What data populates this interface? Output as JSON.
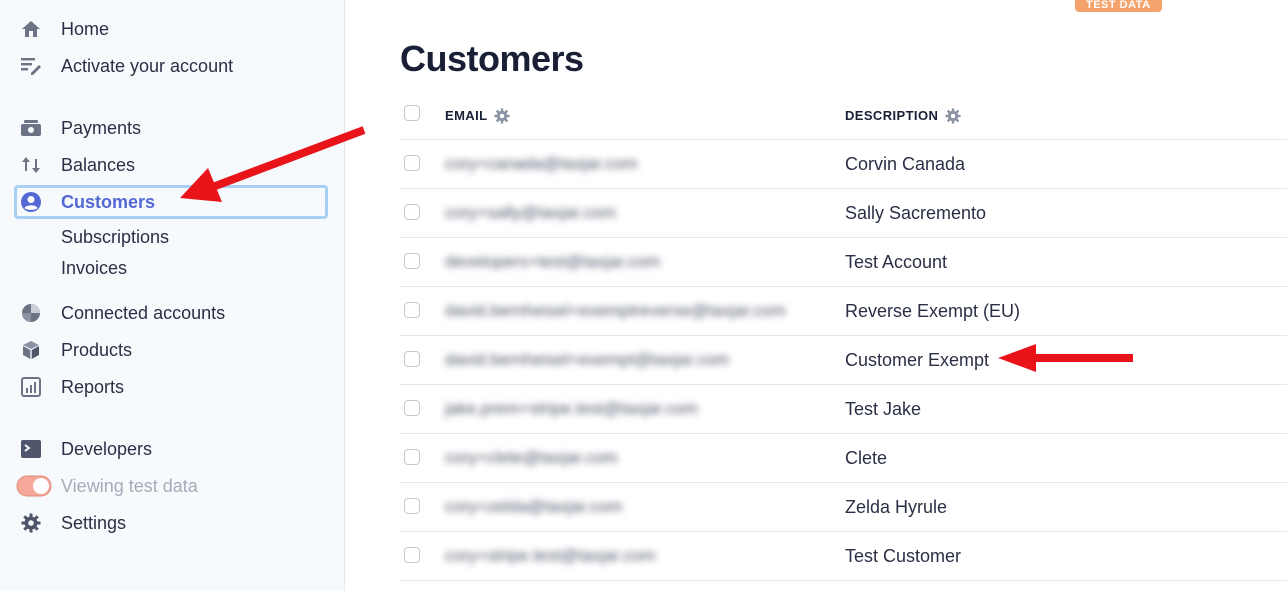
{
  "sidebar": {
    "items": [
      {
        "label": "Home",
        "icon": "home-icon"
      },
      {
        "label": "Activate your account",
        "icon": "edit-list-icon"
      },
      {
        "label": "Payments",
        "icon": "payments-icon"
      },
      {
        "label": "Balances",
        "icon": "balances-icon"
      },
      {
        "label": "Customers",
        "icon": "customers-icon",
        "active": true
      },
      {
        "label": "Subscriptions"
      },
      {
        "label": "Invoices"
      },
      {
        "label": "Connected accounts",
        "icon": "connected-accounts-icon"
      },
      {
        "label": "Products",
        "icon": "products-icon"
      },
      {
        "label": "Reports",
        "icon": "reports-icon"
      },
      {
        "label": "Developers",
        "icon": "terminal-icon"
      },
      {
        "label": "Viewing test data",
        "icon": "toggle-icon"
      },
      {
        "label": "Settings",
        "icon": "gear-icon"
      }
    ]
  },
  "badge": "TEST DATA",
  "main": {
    "title": "Customers",
    "columns": {
      "email": "EMAIL",
      "description": "DESCRIPTION"
    },
    "rows": [
      {
        "email": "cory+canada@taxjar.com",
        "description": "Corvin Canada"
      },
      {
        "email": "cory+sally@taxjar.com",
        "description": "Sally Sacremento"
      },
      {
        "email": "developers+test@taxjar.com",
        "description": "Test Account"
      },
      {
        "email": "david.bernheisel+exemptreverse@taxjar.com",
        "description": "Reverse Exempt (EU)"
      },
      {
        "email": "david.bernheisel+exempt@taxjar.com",
        "description": "Customer Exempt"
      },
      {
        "email": "jake.prem+stripe.test@taxjar.com",
        "description": "Test Jake"
      },
      {
        "email": "cory+clete@taxjar.com",
        "description": "Clete"
      },
      {
        "email": "cory+zelda@taxjar.com",
        "description": "Zelda Hyrule"
      },
      {
        "email": "cory+stripe.test@taxjar.com",
        "description": "Test Customer"
      }
    ]
  },
  "colors": {
    "accent": "#5469d4",
    "active_border": "#a8d0f3",
    "badge": "#f5a36c",
    "annotation_arrow": "#e8141a"
  }
}
